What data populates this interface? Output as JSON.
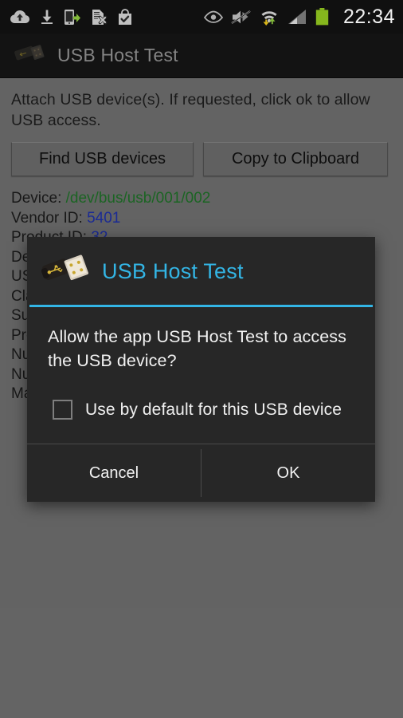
{
  "statusbar": {
    "time": "22:34",
    "left_icons": [
      {
        "name": "cloud-upload-icon"
      },
      {
        "name": "download-icon"
      },
      {
        "name": "phone-transfer-icon"
      },
      {
        "name": "document-error-icon"
      },
      {
        "name": "shopping-bag-check-icon"
      }
    ],
    "right_icons": [
      {
        "name": "eye-icon"
      },
      {
        "name": "mute-vibrate-icon"
      },
      {
        "name": "wifi-data-transfer-icon"
      },
      {
        "name": "cell-signal-icon"
      },
      {
        "name": "battery-icon"
      }
    ]
  },
  "actionbar": {
    "title": "USB Host Test",
    "icon": "usb-connector-icon"
  },
  "main": {
    "instructions": "Attach USB device(s).  If requested, click ok to allow USB access.",
    "find_button_label": "Find USB devices",
    "copy_button_label": "Copy to Clipboard",
    "device_info": [
      {
        "label": "Device:",
        "value": "/dev/bus/usb/001/002",
        "value_color": "green"
      },
      {
        "label": "Vendor ID:",
        "value": "5401",
        "value_color": "blue"
      },
      {
        "label": "Product ID:",
        "value": "32",
        "value_color": "blue"
      },
      {
        "label": "De",
        "value": "",
        "value_color": "none"
      },
      {
        "label": "US",
        "value": "",
        "value_color": "none"
      },
      {
        "label": "Cla",
        "value": "",
        "value_color": "none"
      },
      {
        "label": "Su",
        "value": "",
        "value_color": "none"
      },
      {
        "label": "Pro",
        "value": "",
        "value_color": "none"
      },
      {
        "label": "Nu",
        "value": "",
        "value_color": "none"
      },
      {
        "label": "Nu",
        "value": "",
        "value_color": "none"
      },
      {
        "label": "Ma",
        "value": "",
        "value_color": "none"
      }
    ]
  },
  "dialog": {
    "icon": "usb-connector-icon",
    "title": "USB Host Test",
    "message": "Allow the app USB Host Test to access the USB device?",
    "checkbox_label": "Use by default for this USB device",
    "checkbox_checked": false,
    "cancel_label": "Cancel",
    "ok_label": "OK"
  },
  "colors": {
    "accent_blue": "#33b5e5",
    "dialog_bg": "#272727",
    "content_bg": "#6a6a6a",
    "status_bg": "#121212",
    "device_value_green": "#1d6b26",
    "device_value_blue": "#1d2e9e",
    "battery_green": "#8fc31f"
  }
}
